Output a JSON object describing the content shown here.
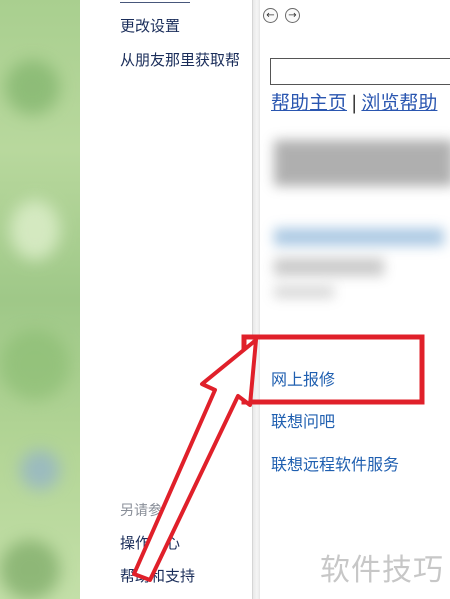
{
  "left_panel": {
    "links": [
      "更改设置",
      "从朋友那里获取帮",
      "操作中心",
      "帮助和支持"
    ],
    "see_also": "另请参阅"
  },
  "help_pane": {
    "nav": {
      "back_icon": "arrow-left-circle",
      "forward_icon": "arrow-right-circle",
      "back_glyph": "←",
      "forward_glyph": "→"
    },
    "top_links": {
      "home": "帮助主页",
      "separator": "|",
      "browse": "浏览帮助"
    },
    "links": [
      "网上报修",
      "联想问吧",
      "联想远程软件服务"
    ]
  },
  "annotation": {
    "color": "#e0202a",
    "highlighted": "网上报修"
  },
  "watermark": "软件技巧"
}
